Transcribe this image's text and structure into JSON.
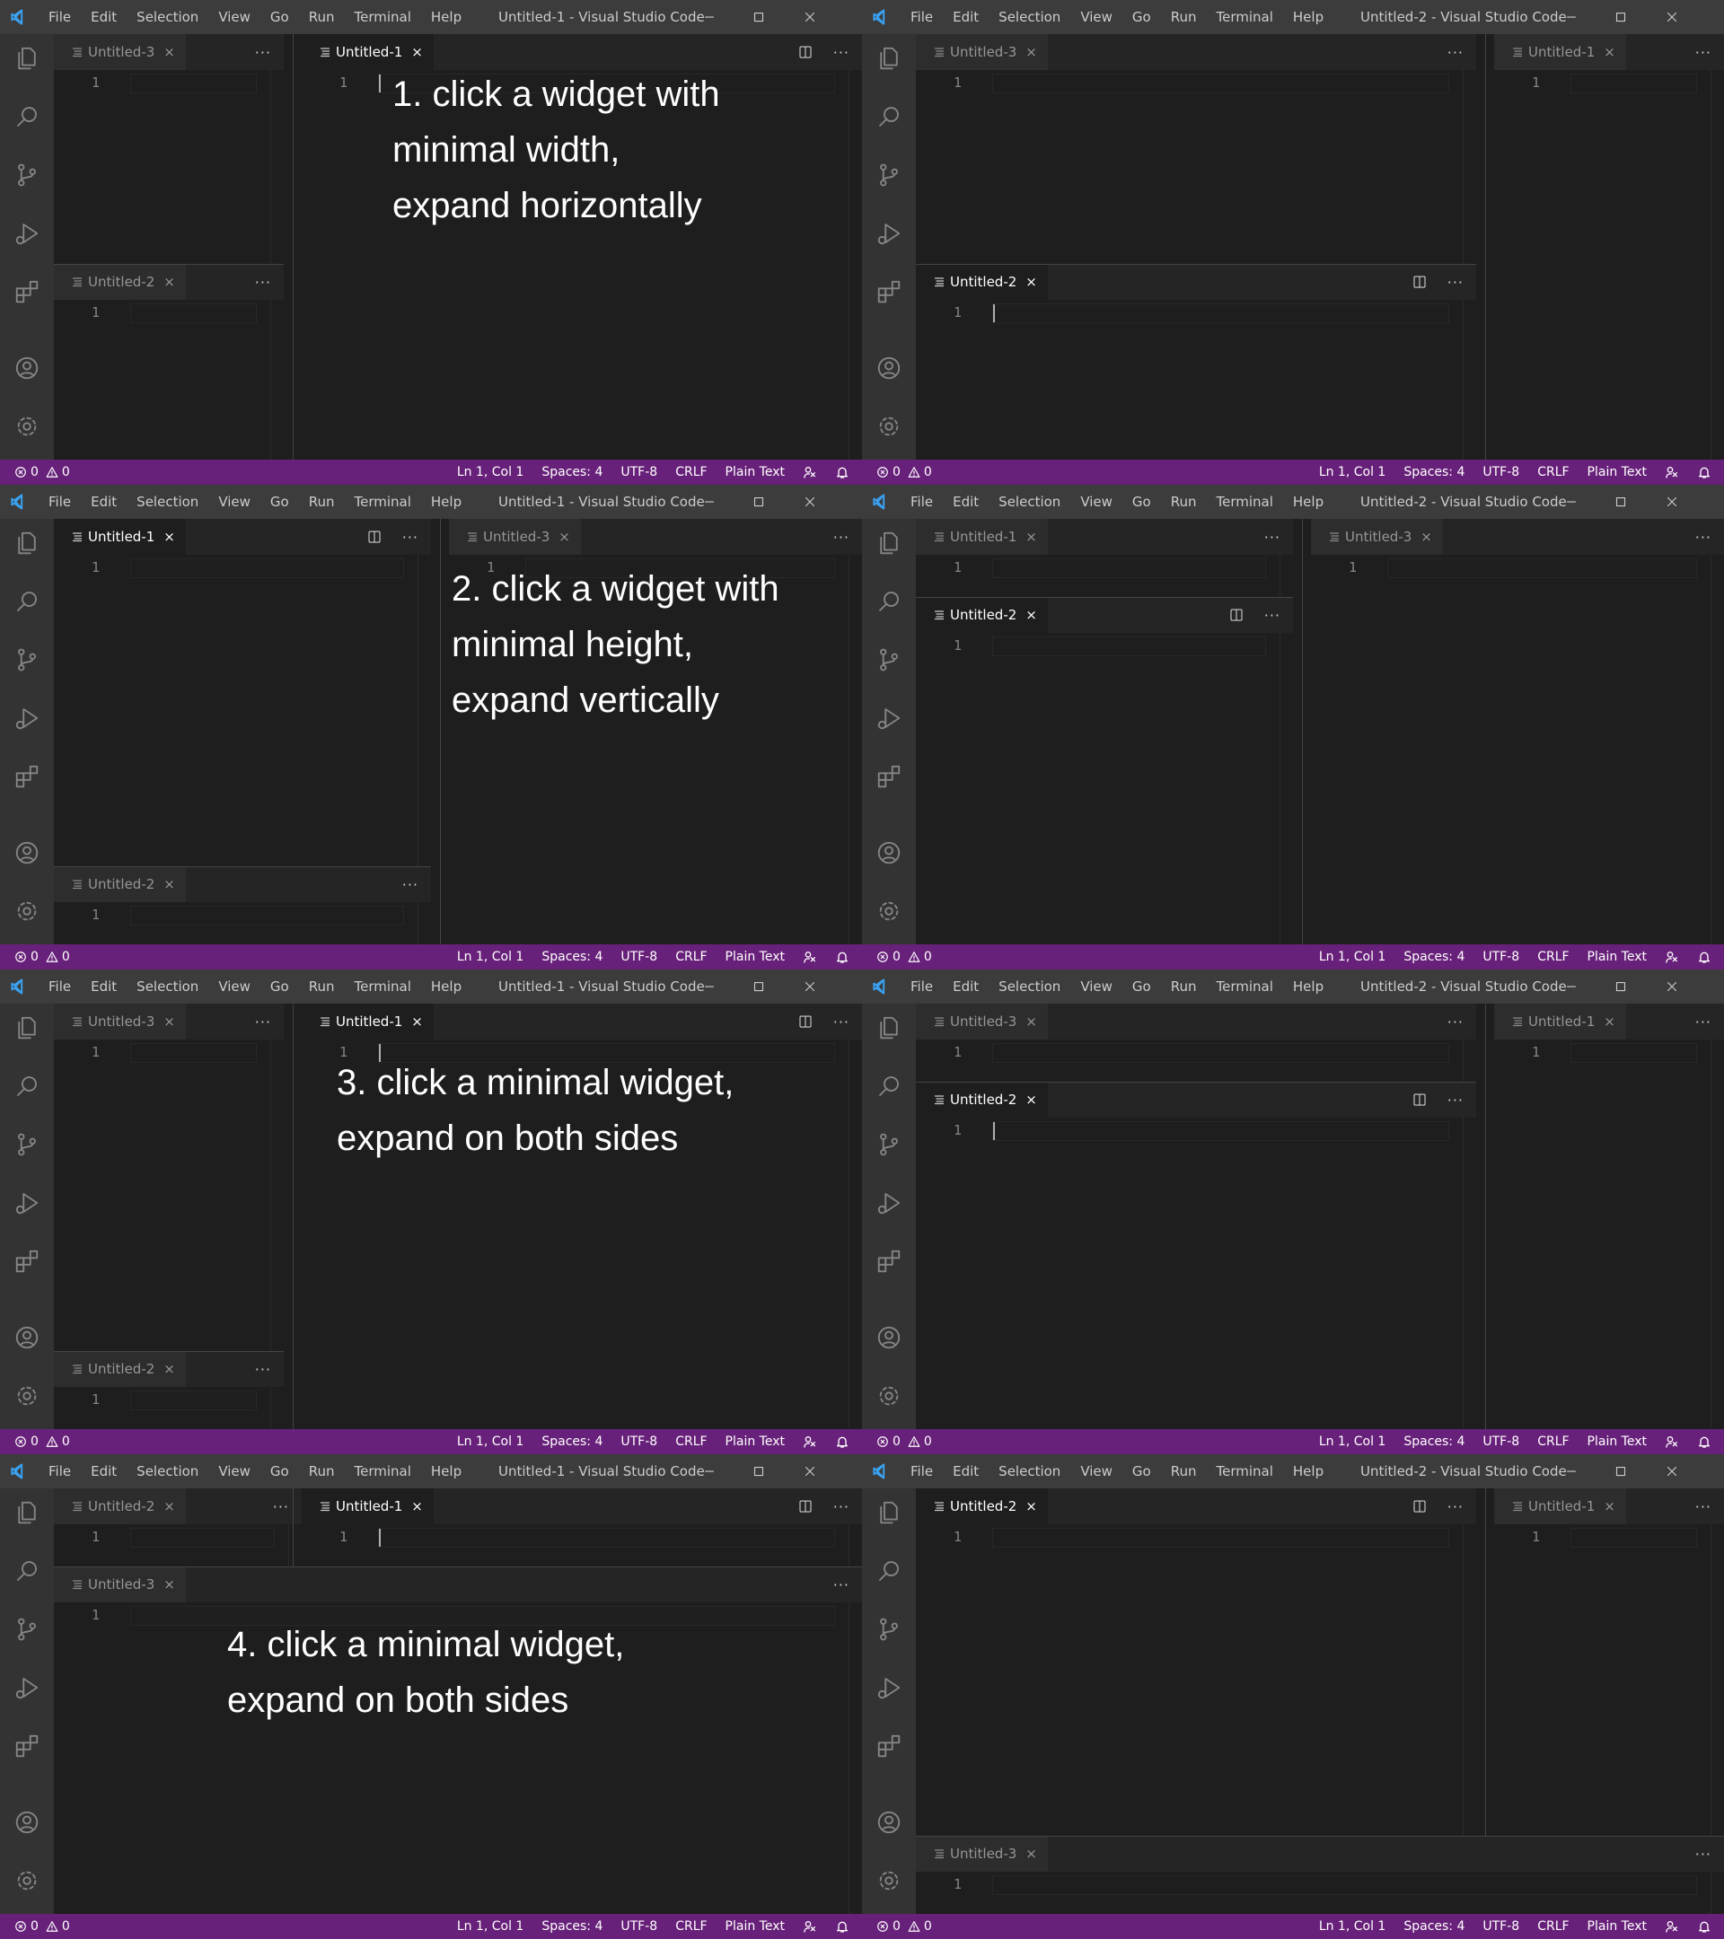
{
  "menu": [
    "File",
    "Edit",
    "Selection",
    "View",
    "Go",
    "Run",
    "Terminal",
    "Help"
  ],
  "window_titles": {
    "w1": "Untitled-1 - Visual Studio Code",
    "w2": "Untitled-2 - Visual Studio Code"
  },
  "tab_names": {
    "u1": "Untitled-1",
    "u2": "Untitled-2",
    "u3": "Untitled-3"
  },
  "tab_close": "×",
  "tab_more": "···",
  "line_number": "1",
  "activity_icons": [
    "explorer-icon",
    "search-icon",
    "source-control-icon",
    "run-debug-icon",
    "extensions-icon",
    "accounts-icon",
    "manage-gear-icon"
  ],
  "statusbar": {
    "errors": "0",
    "warnings": "0",
    "position": "Ln 1, Col 1",
    "spaces": "Spaces: 4",
    "encoding": "UTF-8",
    "eol": "CRLF",
    "language": "Plain Text",
    "feedback_icon": "feedback-icon",
    "bell_icon": "bell-icon"
  },
  "colors": {
    "status_bar": "#68217a",
    "titlebar": "#3c3c3c",
    "activity_bar": "#333333",
    "editor": "#1e1e1e",
    "accent": "#007acc"
  },
  "annotations": [
    [
      "1. click a widget with",
      "minimal width,",
      "expand horizontally"
    ],
    [
      "2. click a widget with",
      "minimal height,",
      "expand vertically"
    ],
    [
      "3. click a minimal widget,",
      "expand on both sides"
    ],
    [
      "4. click a minimal widget,",
      "expand on both sides"
    ]
  ],
  "panels": [
    {
      "title": "w1",
      "annotation": 0,
      "groups": [
        {
          "tab": "u3",
          "active": false,
          "actions": false,
          "cursor": false
        },
        {
          "tab": "u2",
          "active": false,
          "actions": false,
          "cursor": false
        },
        {
          "tab": "u1",
          "active": true,
          "actions": true,
          "cursor": true
        }
      ]
    },
    {
      "title": "w2",
      "annotation": null,
      "groups": [
        {
          "tab": "u3",
          "active": false,
          "actions": false,
          "cursor": false
        },
        {
          "tab": "u2",
          "active": true,
          "actions": true,
          "cursor": true
        },
        {
          "tab": "u1",
          "active": false,
          "actions": false,
          "cursor": false
        }
      ]
    },
    {
      "title": "w1",
      "annotation": 1,
      "groups": [
        {
          "tab": "u1",
          "active": true,
          "actions": true,
          "cursor": false
        },
        {
          "tab": "u2",
          "active": false,
          "actions": false,
          "cursor": false
        },
        {
          "tab": "u3",
          "active": false,
          "actions": false,
          "cursor": false
        }
      ]
    },
    {
      "title": "w2",
      "annotation": null,
      "groups": [
        {
          "tab": "u1",
          "active": false,
          "actions": false,
          "cursor": false
        },
        {
          "tab": "u2",
          "active": true,
          "actions": true,
          "cursor": false
        },
        {
          "tab": "u3",
          "active": false,
          "actions": false,
          "cursor": false
        }
      ]
    },
    {
      "title": "w1",
      "annotation": 2,
      "groups": [
        {
          "tab": "u3",
          "active": false,
          "actions": false,
          "cursor": false
        },
        {
          "tab": "u2",
          "active": false,
          "actions": false,
          "cursor": false
        },
        {
          "tab": "u1",
          "active": true,
          "actions": true,
          "cursor": true
        }
      ]
    },
    {
      "title": "w2",
      "annotation": null,
      "groups": [
        {
          "tab": "u3",
          "active": false,
          "actions": false,
          "cursor": false
        },
        {
          "tab": "u2",
          "active": true,
          "actions": true,
          "cursor": true
        },
        {
          "tab": "u1",
          "active": false,
          "actions": false,
          "cursor": false
        }
      ]
    },
    {
      "title": "w1",
      "annotation": 3,
      "groups": [
        {
          "tab": "u2",
          "active": false,
          "actions": false,
          "cursor": false
        },
        {
          "tab": "u1",
          "active": true,
          "actions": true,
          "cursor": true
        },
        {
          "tab": "u3",
          "active": false,
          "actions": false,
          "cursor": false
        }
      ]
    },
    {
      "title": "w2",
      "annotation": null,
      "groups": [
        {
          "tab": "u2",
          "active": true,
          "actions": true,
          "cursor": false
        },
        {
          "tab": "u1",
          "active": false,
          "actions": false,
          "cursor": false
        },
        {
          "tab": "u3",
          "active": false,
          "actions": false,
          "cursor": false
        }
      ]
    }
  ]
}
